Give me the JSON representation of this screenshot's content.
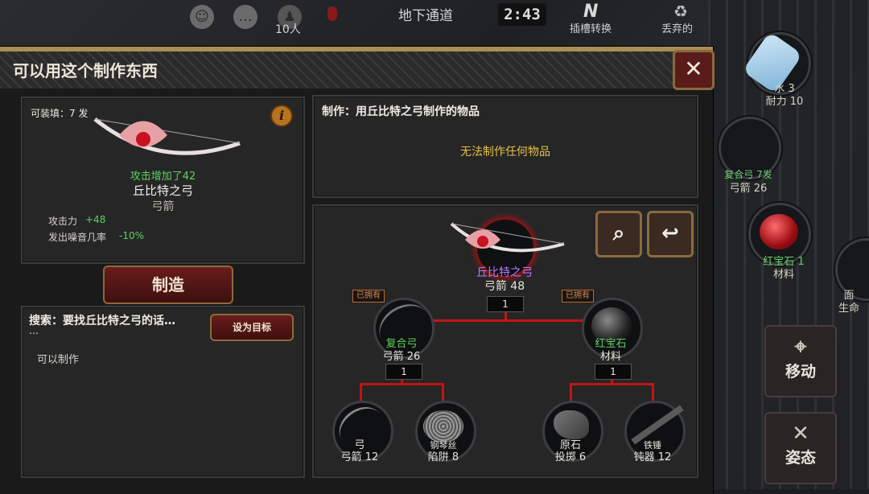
{
  "topbar": {
    "players": "10人",
    "location": "地下通道",
    "time": "2:43",
    "swap_label": "插槽转换",
    "swap_letter": "N",
    "discard_label": "丢弃的"
  },
  "inventory": [
    {
      "name": "水 3",
      "detail": "耐力 10"
    },
    {
      "name": "复合弓 7发",
      "detail": "弓箭 26"
    },
    {
      "name": "红宝石 1",
      "detail": "材料"
    },
    {
      "name": "面",
      "detail": "生命"
    }
  ],
  "side_buttons": {
    "move": "移动",
    "stance": "姿态"
  },
  "panel": {
    "title": "可以用这个制作东西",
    "close": "✕"
  },
  "item": {
    "loaded": "可装填：7 发",
    "bonus": "攻击增加了42",
    "name": "丘比特之弓",
    "type": "弓箭",
    "stats": [
      {
        "label": "攻击力",
        "value": "+48"
      },
      {
        "label": "发出噪音几率",
        "value": "-10%"
      }
    ]
  },
  "craft_button": "制造",
  "search": {
    "label": "搜索：要找丘比特之弓的话…",
    "ellipsis": "…",
    "set_goal": "设为目标",
    "result": "可以制作"
  },
  "craft_with": {
    "title": "制作：用丘比特之弓制作的物品",
    "empty": "无法制作任何物品"
  },
  "tree": {
    "root": {
      "name": "丘比特之弓",
      "detail": "弓箭 48",
      "qty": "1"
    },
    "left": {
      "name": "复合弓",
      "detail": "弓箭 26",
      "qty": "1",
      "have": "已拥有"
    },
    "right": {
      "name": "红宝石",
      "detail": "材料",
      "qty": "1",
      "have": "已拥有"
    },
    "leaves": [
      {
        "name": "弓",
        "detail": "弓箭 12"
      },
      {
        "name": "钢琴丝",
        "detail": "陷阱 8"
      },
      {
        "name": "原石",
        "detail": "投掷 6"
      },
      {
        "name": "铁锤",
        "detail": "钝器 12"
      }
    ]
  },
  "colors": {
    "accent_gold": "#a88d55",
    "red_line": "#c21414",
    "green": "#5fd05f",
    "purple": "#b57cff"
  }
}
